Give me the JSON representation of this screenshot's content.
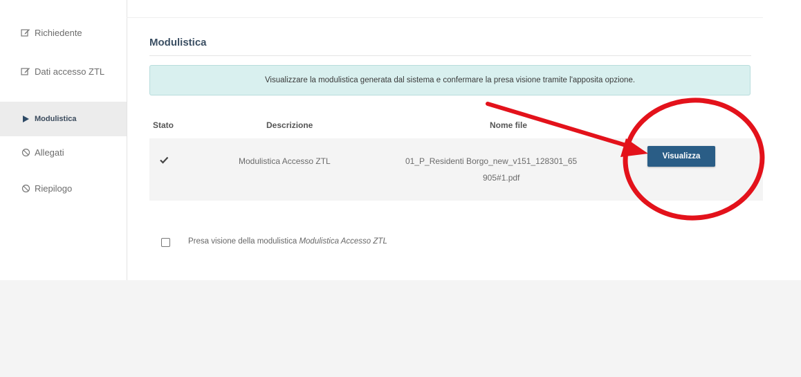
{
  "sidebar": {
    "items": [
      {
        "label": "Richiedente",
        "icon": "edit-icon"
      },
      {
        "label": "Dati accesso ZTL",
        "icon": "edit-icon"
      },
      {
        "label": "Modulistica",
        "icon": "play-icon",
        "active": true
      },
      {
        "label": "Allegati",
        "icon": "ban-icon"
      },
      {
        "label": "Riepilogo",
        "icon": "ban-icon"
      }
    ]
  },
  "main": {
    "title": "Modulistica",
    "info": "Visualizzare la modulistica generata dal sistema e confermare la presa visione tramite l'apposita opzione.",
    "table": {
      "headers": {
        "stato": "Stato",
        "descrizione": "Descrizione",
        "nome_file": "Nome file"
      },
      "rows": [
        {
          "descrizione": "Modulistica Accesso ZTL",
          "nome_file_line1": "01_P_Residenti Borgo_new_v151_128301_65",
          "nome_file_line2": "905#1.pdf",
          "button": "Visualizza"
        }
      ]
    },
    "confirm": {
      "text": "Presa visione della modulistica ",
      "doc": "Modulistica Accesso ZTL"
    }
  },
  "annotation": {
    "color": "#e3121b"
  }
}
